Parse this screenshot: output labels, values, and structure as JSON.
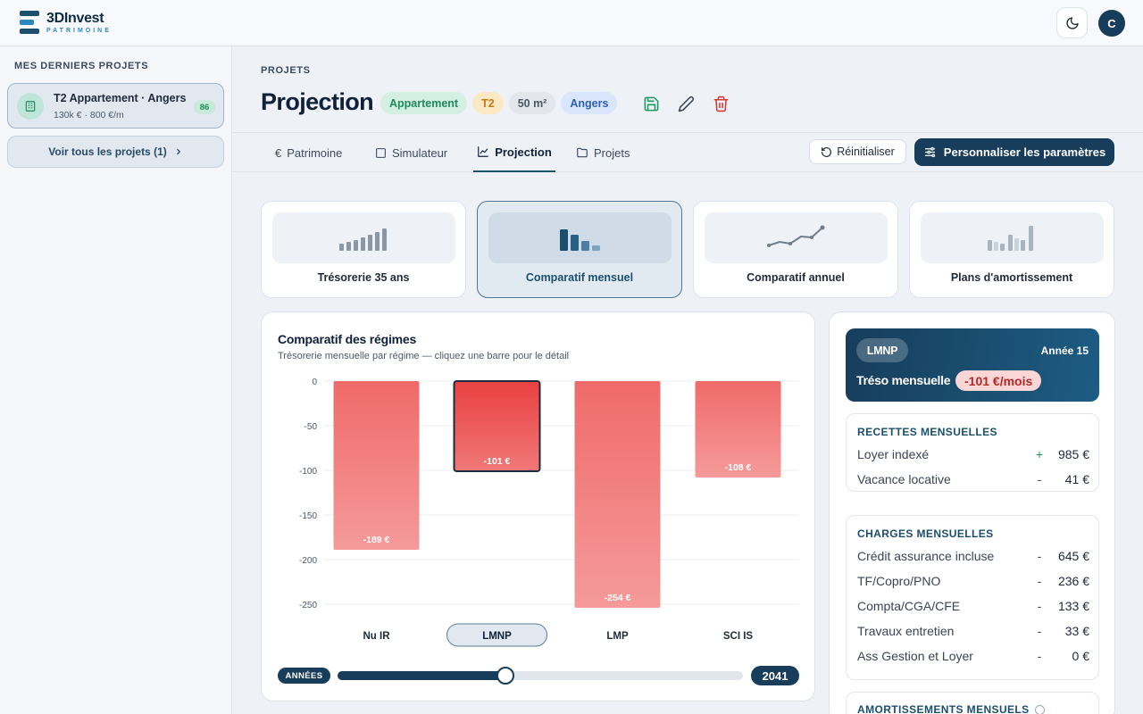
{
  "app": {
    "brand": "3DInvest",
    "brand_sub": "PATRIMOINE",
    "avatar_initial": "C"
  },
  "sidebar": {
    "title": "MES DERNIERS PROJETS",
    "project": {
      "name": "T2 Appartement · Angers",
      "meta": "130k € · 800 €/m",
      "score": "86"
    },
    "see_all": "Voir tous les projets (1)"
  },
  "header": {
    "breadcrumb": "PROJETS",
    "title": "Projection",
    "tags": [
      "Appartement",
      "T2",
      "50 m²",
      "Angers"
    ]
  },
  "tabs": [
    "Patrimoine",
    "Simulateur",
    "Projection",
    "Projets"
  ],
  "active_tab": "Projection",
  "actions": {
    "reset": "Réinitialiser",
    "params": "Personnaliser les paramètres"
  },
  "views": [
    "Trésorerie 35 ans",
    "Comparatif mensuel",
    "Comparatif annuel",
    "Plans d'amortissement"
  ],
  "active_view": "Comparatif mensuel",
  "chart": {
    "title": "Comparatif des régimes",
    "subtitle": "Trésorerie mensuelle par régime — cliquez une barre pour le détail",
    "years_label": "ANNÉES",
    "year_value": "2041",
    "slider_fraction": 0.415
  },
  "chart_data": {
    "type": "bar",
    "categories": [
      "Nu IR",
      "LMNP",
      "LMP",
      "SCI IS"
    ],
    "values": [
      -189,
      -101,
      -254,
      -108
    ],
    "data_labels": [
      "-189 €",
      "-101 €",
      "-254 €",
      "-108 €"
    ],
    "ylim": [
      -260,
      0
    ],
    "yticks": [
      0,
      -50,
      -100,
      -150,
      -200,
      -250
    ],
    "ytick_labels": [
      "0",
      "-50",
      "-100",
      "-150",
      "-200",
      "-250"
    ],
    "selected": "LMNP",
    "grid": true,
    "colors": {
      "bar": "#f07878",
      "bar_selected": "#e84545",
      "selected_outline": "#1a2c40"
    }
  },
  "detail": {
    "regime": "LMNP",
    "year_label": "Année 15",
    "treso_label": "Tréso mensuelle",
    "treso_value": "-101 €/mois",
    "recettes": {
      "title": "RECETTES MENSUELLES",
      "rows": [
        {
          "label": "Loyer indexé",
          "sign": "+",
          "value": "985 €"
        },
        {
          "label": "Vacance locative",
          "sign": "-",
          "value": "41 €"
        }
      ]
    },
    "charges": {
      "title": "CHARGES MENSUELLES",
      "rows": [
        {
          "label": "Crédit assurance incluse",
          "sign": "-",
          "value": "645 €"
        },
        {
          "label": "TF/Copro/PNO",
          "sign": "-",
          "value": "236 €"
        },
        {
          "label": "Compta/CGA/CFE",
          "sign": "-",
          "value": "133 €"
        },
        {
          "label": "Travaux entretien",
          "sign": "-",
          "value": "33 €"
        },
        {
          "label": "Ass Gestion et Loyer",
          "sign": "-",
          "value": "0 €"
        }
      ]
    },
    "amortissements": {
      "title": "AMORTISSEMENTS MENSUELS"
    }
  }
}
